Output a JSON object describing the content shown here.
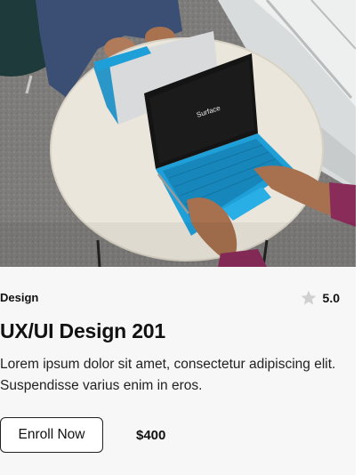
{
  "hero": {
    "laptop_screen_text": "Surface",
    "colors": {
      "table": "#ece8df",
      "keyboard": "#1e9fd8",
      "floor": "#8a8a8a",
      "sleeve": "#8a2c5a"
    }
  },
  "course": {
    "category": "Design",
    "rating": "5.0",
    "rating_icon": "star-icon",
    "title": "UX/UI Design 201",
    "description": "Lorem ipsum dolor sit amet, consectetur adipiscing elit. Suspendisse varius enim in eros.",
    "enroll_label": "Enroll Now",
    "price": "$400"
  }
}
